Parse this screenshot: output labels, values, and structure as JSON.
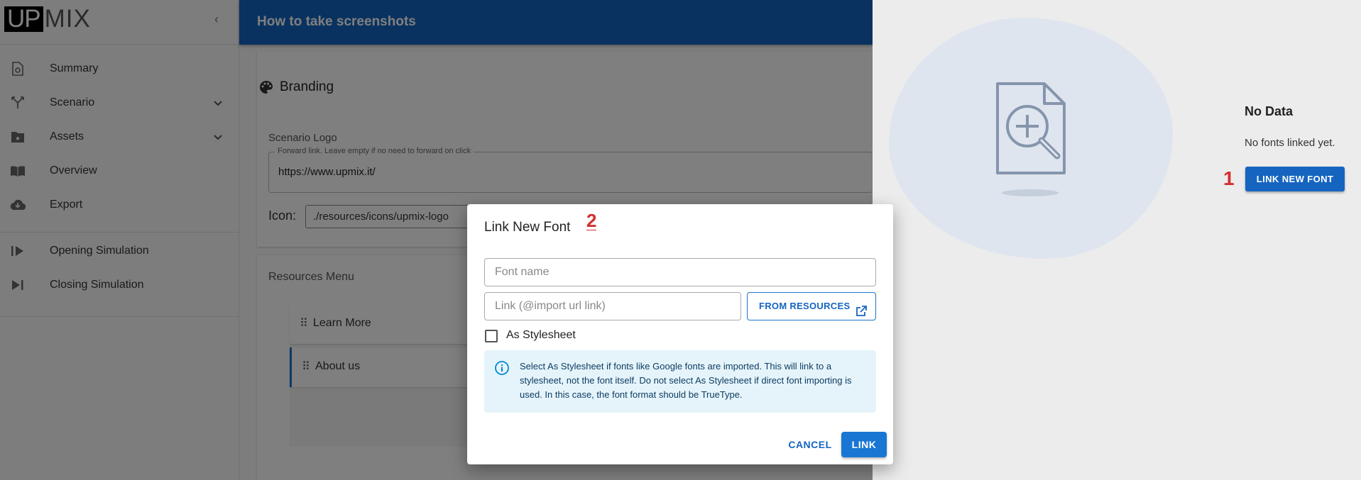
{
  "app": {
    "logo_up": "UP",
    "logo_mix": "MIX"
  },
  "sidebar": {
    "items": [
      {
        "label": "Summary",
        "icon": "summary-icon"
      },
      {
        "label": "Scenario",
        "icon": "scenario-icon",
        "expandable": true
      },
      {
        "label": "Assets",
        "icon": "folder-icon",
        "expandable": true
      },
      {
        "label": "Overview",
        "icon": "book-icon"
      },
      {
        "label": "Export",
        "icon": "cloud-download-icon"
      },
      {
        "label": "Opening Simulation",
        "icon": "play-icon"
      },
      {
        "label": "Closing Simulation",
        "icon": "skip-next-icon"
      }
    ]
  },
  "header": {
    "title": "How to take screenshots"
  },
  "branding": {
    "title": "Branding",
    "logo_label": "Scenario Logo",
    "forward_legend": "Forward link. Leave empty if no need to forward on click",
    "forward_value": "https://www.upmix.it/",
    "icon_label": "Icon:",
    "icon_value": "./resources/icons/upmix-logo"
  },
  "resources": {
    "title": "Resources Menu",
    "items": [
      {
        "label": "Learn More"
      },
      {
        "label": "About us"
      }
    ]
  },
  "drawer": {
    "nodata_title": "No Data",
    "nodata_text": "No fonts linked yet.",
    "marker": "1",
    "link_new_font_button": "LINK NEW FONT"
  },
  "dialog": {
    "title": "Link New Font",
    "marker": "2",
    "font_name_placeholder": "Font name",
    "link_placeholder": "Link (@import url link)",
    "from_resources_button": "FROM RESOURCES",
    "stylesheet_label": "As Stylesheet",
    "stylesheet_checked": false,
    "info_text": "Select As Stylesheet if fonts like Google fonts are imported. This will link to a stylesheet, not the font itself. Do not select As Stylesheet if direct font importing is used. In this case, the font format should be TrueType.",
    "cancel_button": "CANCEL",
    "link_button": "LINK"
  },
  "colors": {
    "primary": "#1976d2",
    "header": "#1565c0",
    "marker": "#d32f2f",
    "info_bg": "#e5f4fb"
  }
}
